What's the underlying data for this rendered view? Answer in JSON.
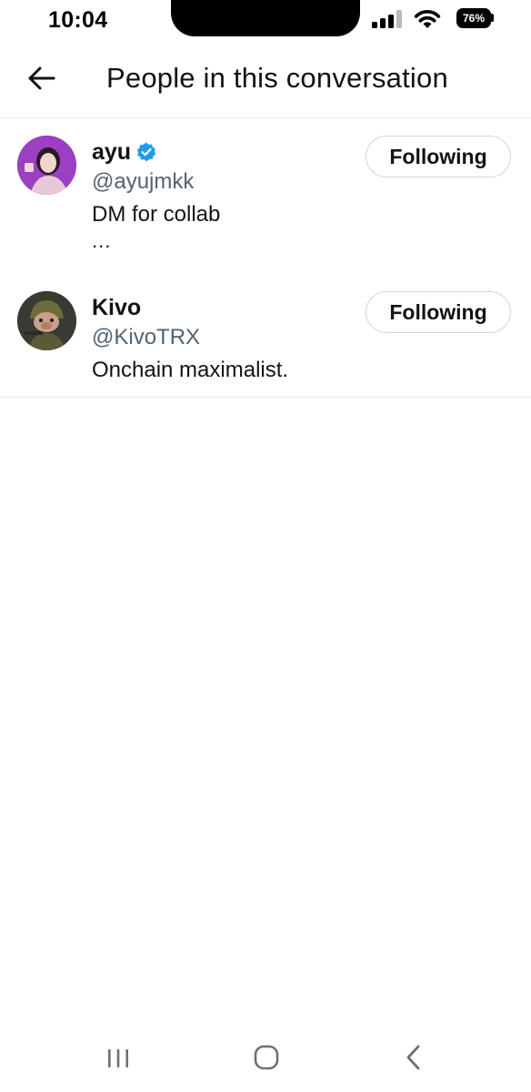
{
  "status_bar": {
    "time": "10:04",
    "battery_percent": "76%",
    "signal_level": 0.75,
    "icons": [
      "signal-icon",
      "wifi-icon",
      "battery-icon"
    ]
  },
  "header": {
    "title": "People in this conversation",
    "back_icon": "arrow-left-icon"
  },
  "people": [
    {
      "display_name": "ayu",
      "handle": "@ayujmkk",
      "verified": true,
      "bio": "DM for collab",
      "bio_more": "...",
      "follow_label": "Following"
    },
    {
      "display_name": "Kivo",
      "handle": "@KivoTRX",
      "verified": false,
      "bio": "Onchain maximalist.",
      "follow_label": "Following"
    }
  ],
  "nav_bar": {
    "icons": [
      "recents-icon",
      "home-icon",
      "back-chevron-icon"
    ]
  },
  "colors": {
    "text_primary": "#0f1419",
    "text_secondary": "#536471",
    "verified_blue": "#1d9bf0",
    "divider": "#e6e9ec",
    "button_border": "#cfd9de"
  }
}
